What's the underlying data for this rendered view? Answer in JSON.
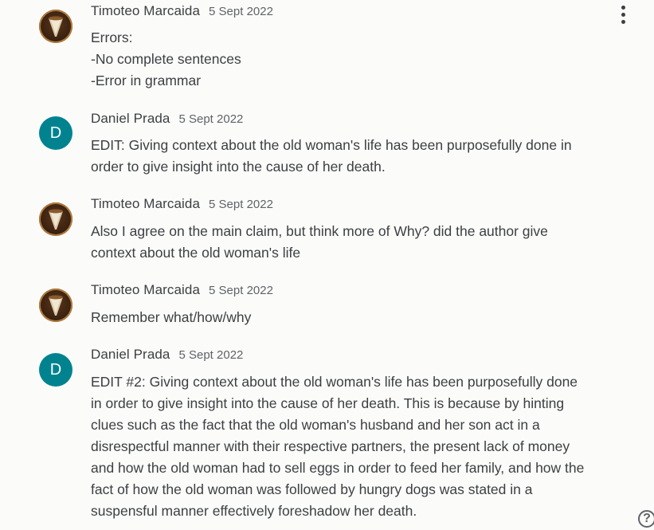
{
  "comments": [
    {
      "author": "Timoteo Marcaida",
      "date": "5 Sept 2022",
      "avatar": "photo",
      "lines": [
        "Errors:",
        "-No complete sentences",
        "-Error in grammar"
      ]
    },
    {
      "author": "Daniel Prada",
      "date": "5 Sept 2022",
      "avatar": "D",
      "lines": [
        "EDIT: Giving context about the old woman's life has been purposefully done in",
        "order to give insight into the cause of her death."
      ]
    },
    {
      "author": "Timoteo Marcaida",
      "date": "5 Sept 2022",
      "avatar": "photo",
      "lines": [
        "Also I agree on the main claim, but think more of Why? did the author give",
        "context about the old woman's life"
      ]
    },
    {
      "author": "Timoteo Marcaida",
      "date": "5 Sept 2022",
      "avatar": "photo",
      "lines": [
        "Remember what/how/why"
      ]
    },
    {
      "author": "Daniel Prada",
      "date": "5 Sept 2022",
      "avatar": "D",
      "lines": [
        "EDIT #2: Giving context about the old woman's life has been purposefully done",
        "in order to give insight into the cause of her death. This is because by hinting",
        "clues such as the fact that the old woman's husband and her son act in a",
        "disrespectful manner with their respective partners, the present lack of money",
        "and how the old woman had to sell eggs in order to feed her family, and how the",
        "fact of how the old woman was followed by hungry dogs was stated in a",
        "suspensful manner effectively foreshadow her death."
      ]
    }
  ],
  "icons": {
    "more": "more-vert-icon",
    "help": "help-icon",
    "help_glyph": "?"
  },
  "colors": {
    "letter_avatar": "#00838f",
    "background": "#fbfbf9"
  }
}
